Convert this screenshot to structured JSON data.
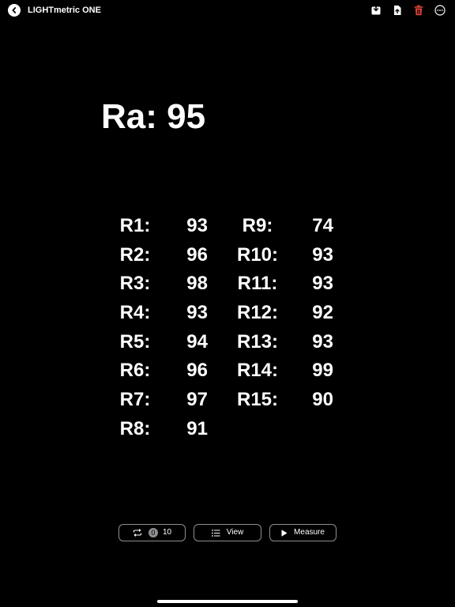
{
  "header": {
    "title": "LIGHTmetric ONE",
    "back_icon": "chevron-left-icon",
    "actions": [
      {
        "name": "save-icon",
        "color": "#ffffff"
      },
      {
        "name": "export-icon",
        "color": "#ffffff"
      },
      {
        "name": "trash-icon",
        "color": "#e0443b"
      },
      {
        "name": "more-icon",
        "color": "#ffffff"
      }
    ]
  },
  "ra": {
    "label": "Ra:",
    "value": "95"
  },
  "r_values": {
    "left": [
      {
        "label": "R1:",
        "value": "93"
      },
      {
        "label": "R2:",
        "value": "96"
      },
      {
        "label": "R3:",
        "value": "98"
      },
      {
        "label": "R4:",
        "value": "93"
      },
      {
        "label": "R5:",
        "value": "94"
      },
      {
        "label": "R6:",
        "value": "96"
      },
      {
        "label": "R7:",
        "value": "97"
      },
      {
        "label": "R8:",
        "value": "91"
      }
    ],
    "right": [
      {
        "label": "R9:",
        "value": "74"
      },
      {
        "label": "R10:",
        "value": "93"
      },
      {
        "label": "R11:",
        "value": "93"
      },
      {
        "label": "R12:",
        "value": "92"
      },
      {
        "label": "R13:",
        "value": "93"
      },
      {
        "label": "R14:",
        "value": "99"
      },
      {
        "label": "R15:",
        "value": "90"
      }
    ]
  },
  "controls": {
    "repeat": {
      "badge": "0",
      "count": "10",
      "icon": "repeat-icon"
    },
    "view": {
      "label": "View",
      "icon": "list-icon"
    },
    "measure": {
      "label": "Measure",
      "icon": "play-icon"
    }
  },
  "colors": {
    "background": "#000000",
    "text": "#ffffff",
    "border": "#8e8e93",
    "destructive": "#e0443b"
  }
}
